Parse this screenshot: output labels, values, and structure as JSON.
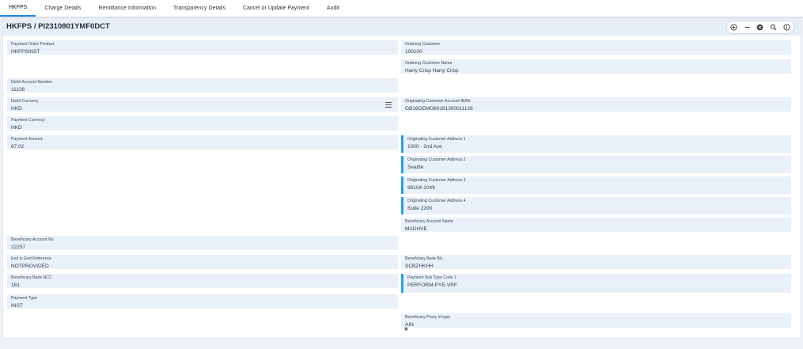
{
  "tabs": [
    {
      "label": "HKFPS"
    },
    {
      "label": "Charge Details"
    },
    {
      "label": "Remittance Information"
    },
    {
      "label": "Transparency Details"
    },
    {
      "label": "Cancel or Update Payment"
    },
    {
      "label": "Audit"
    }
  ],
  "header": {
    "title": "HKFPS / PI2310801YMF0DCT"
  },
  "toolbar": [
    "plus-circle-icon",
    "minus-icon",
    "close-circle-icon",
    "search-icon",
    "info-icon"
  ],
  "left_fields": {
    "payment_order_product": {
      "label": "Payment Order Product",
      "value": "HKFPSINST"
    },
    "debit_account_number": {
      "label": "Debit Account Number",
      "value": "11126"
    },
    "debit_currency": {
      "label": "Debit Currency",
      "value": "HKD"
    },
    "payment_currency": {
      "label": "Payment Currency",
      "value": "HKD"
    },
    "payment_amount": {
      "label": "Payment Amount",
      "value": "67.02"
    },
    "beneficiary_account_no": {
      "label": "Beneficiary Account No",
      "value": "22257"
    },
    "end_to_end_reference": {
      "label": "End to End Reference",
      "value": "NOTPROVIDED"
    },
    "beneficiary_bank_ncc": {
      "label": "Beneficiary Bank NCC",
      "value": "161"
    },
    "payment_type": {
      "label": "Payment Type",
      "value": "INST"
    }
  },
  "right_fields": {
    "ordering_customer": {
      "label": "Ordering Customer",
      "value": "100100"
    },
    "ordering_customer_name": {
      "label": "Ordering Customer Name",
      "value": "Harry Crisp Harry Crisp"
    },
    "originating_customer_account_iban": {
      "label": "Originating Customer Account IBAN",
      "value": "GB16DEMO60161300011126"
    },
    "originating_customer_address_1": {
      "label": "Originating Customer Address 1",
      "value": "1000 - 2nd Ave"
    },
    "originating_customer_address_2": {
      "label": "Originating Customer Address 2",
      "value": "Seattle"
    },
    "originating_customer_address_3": {
      "label": "Originating Customer Address 3",
      "value": "98104-1049"
    },
    "originating_customer_address_4": {
      "label": "Originating Customer Address 4",
      "value": "Suite 2200"
    },
    "beneficiary_account_name": {
      "label": "Beneficiary Account Name",
      "value": "MADHVE"
    },
    "beneficiary_bank_bic": {
      "label": "Beneficiary Bank Bic",
      "value": "SCBZHKHH"
    },
    "payment_sub_type_code_1": {
      "label": "Payment Sub Type Code 1",
      "value": "PERFORM-PYE-VRF"
    },
    "beneficiary_proxy_id_type": {
      "label": "Beneficiary Proxy id type",
      "value": "AIN"
    }
  },
  "colors": {
    "accent": "#29a3d8",
    "field_bg": "#e9f0f8",
    "active_tab": "#1e88e5"
  }
}
